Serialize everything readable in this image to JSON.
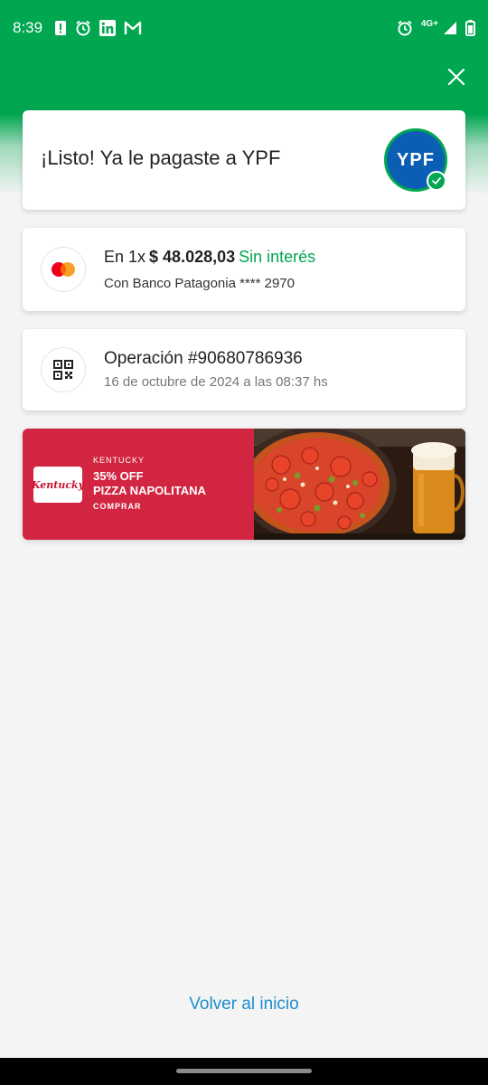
{
  "status_bar": {
    "time": "8:39",
    "network": "4G+",
    "left_icons": [
      "alert-icon",
      "alarm-icon",
      "linkedin-icon",
      "gmail-icon"
    ],
    "right_icons": [
      "alarm-icon",
      "signal-icon",
      "battery-icon"
    ]
  },
  "header": {
    "close_icon": "close-icon",
    "color": "#00a650"
  },
  "success": {
    "title": "¡Listo! Ya le pagaste a YPF",
    "merchant_logo_text": "YPF",
    "merchant_color": "#0a5fb4"
  },
  "payment": {
    "installments": "En 1x",
    "amount": "$ 48.028,03",
    "interest": "Sin interés",
    "bank": "Con Banco Patagonia **** 2970",
    "icon": "mastercard-icon"
  },
  "operation": {
    "number": "Operación #90680786936",
    "date": "16 de octubre de 2024 a las 08:37 hs",
    "icon": "qr-code-icon"
  },
  "promo": {
    "logo_text": "Kentucky",
    "brand": "KENTUCKY",
    "discount": "35% OFF",
    "product": "PIZZA NAPOLITANA",
    "cta": "COMPRAR",
    "color": "#d12541"
  },
  "footer": {
    "back_label": "Volver al inicio",
    "link_color": "#1a8ecf"
  }
}
